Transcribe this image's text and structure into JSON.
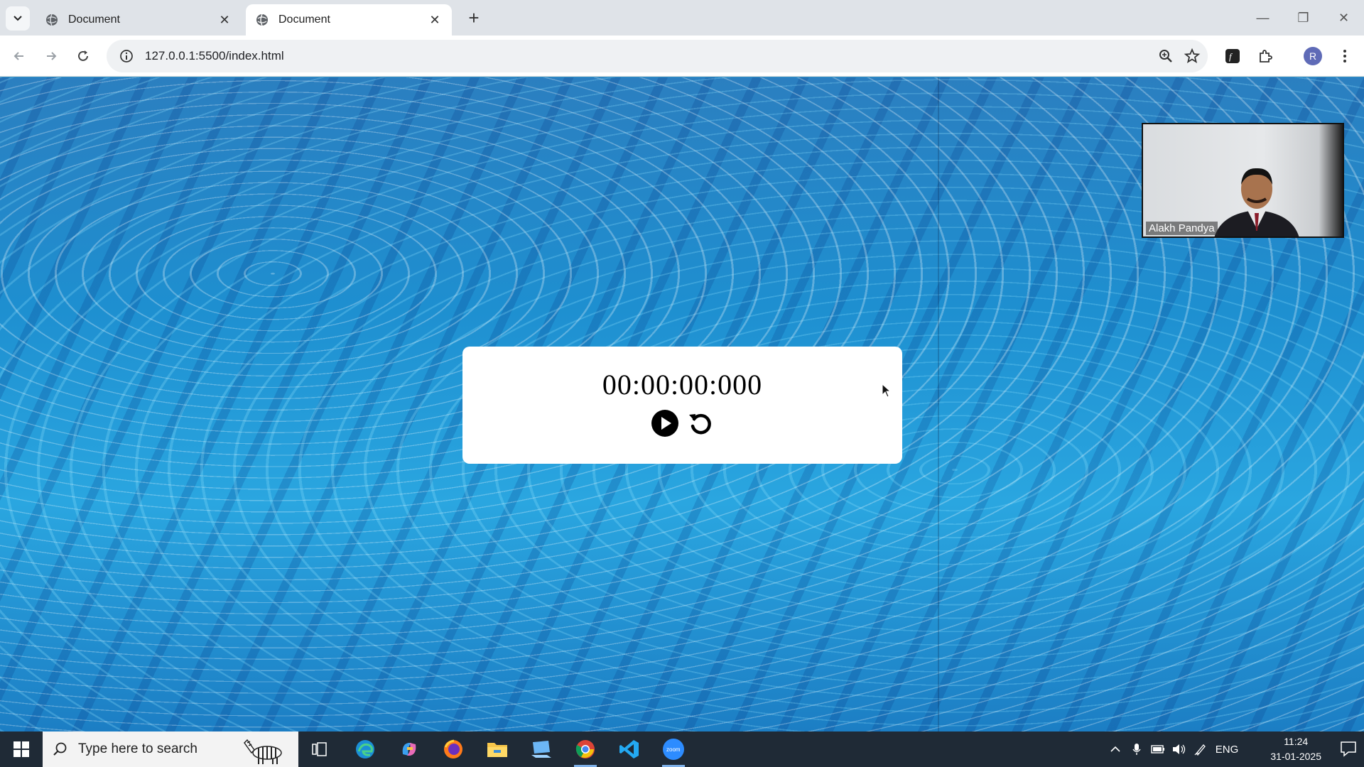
{
  "browser": {
    "tabs": [
      {
        "title": "Document",
        "active": false
      },
      {
        "title": "Document",
        "active": true
      }
    ],
    "url": "127.0.0.1:5500/index.html",
    "profile_initial": "R"
  },
  "stopwatch": {
    "time": "00:00:00:000"
  },
  "video_call": {
    "participant_name": "Alakh Pandya"
  },
  "taskbar": {
    "search_placeholder": "Type here to search",
    "language": "ENG",
    "time": "11:24",
    "date": "31-01-2025"
  },
  "colors": {
    "water": "#2196d3",
    "taskbar": "#1f2a36",
    "omnibox": "#eff1f3"
  }
}
